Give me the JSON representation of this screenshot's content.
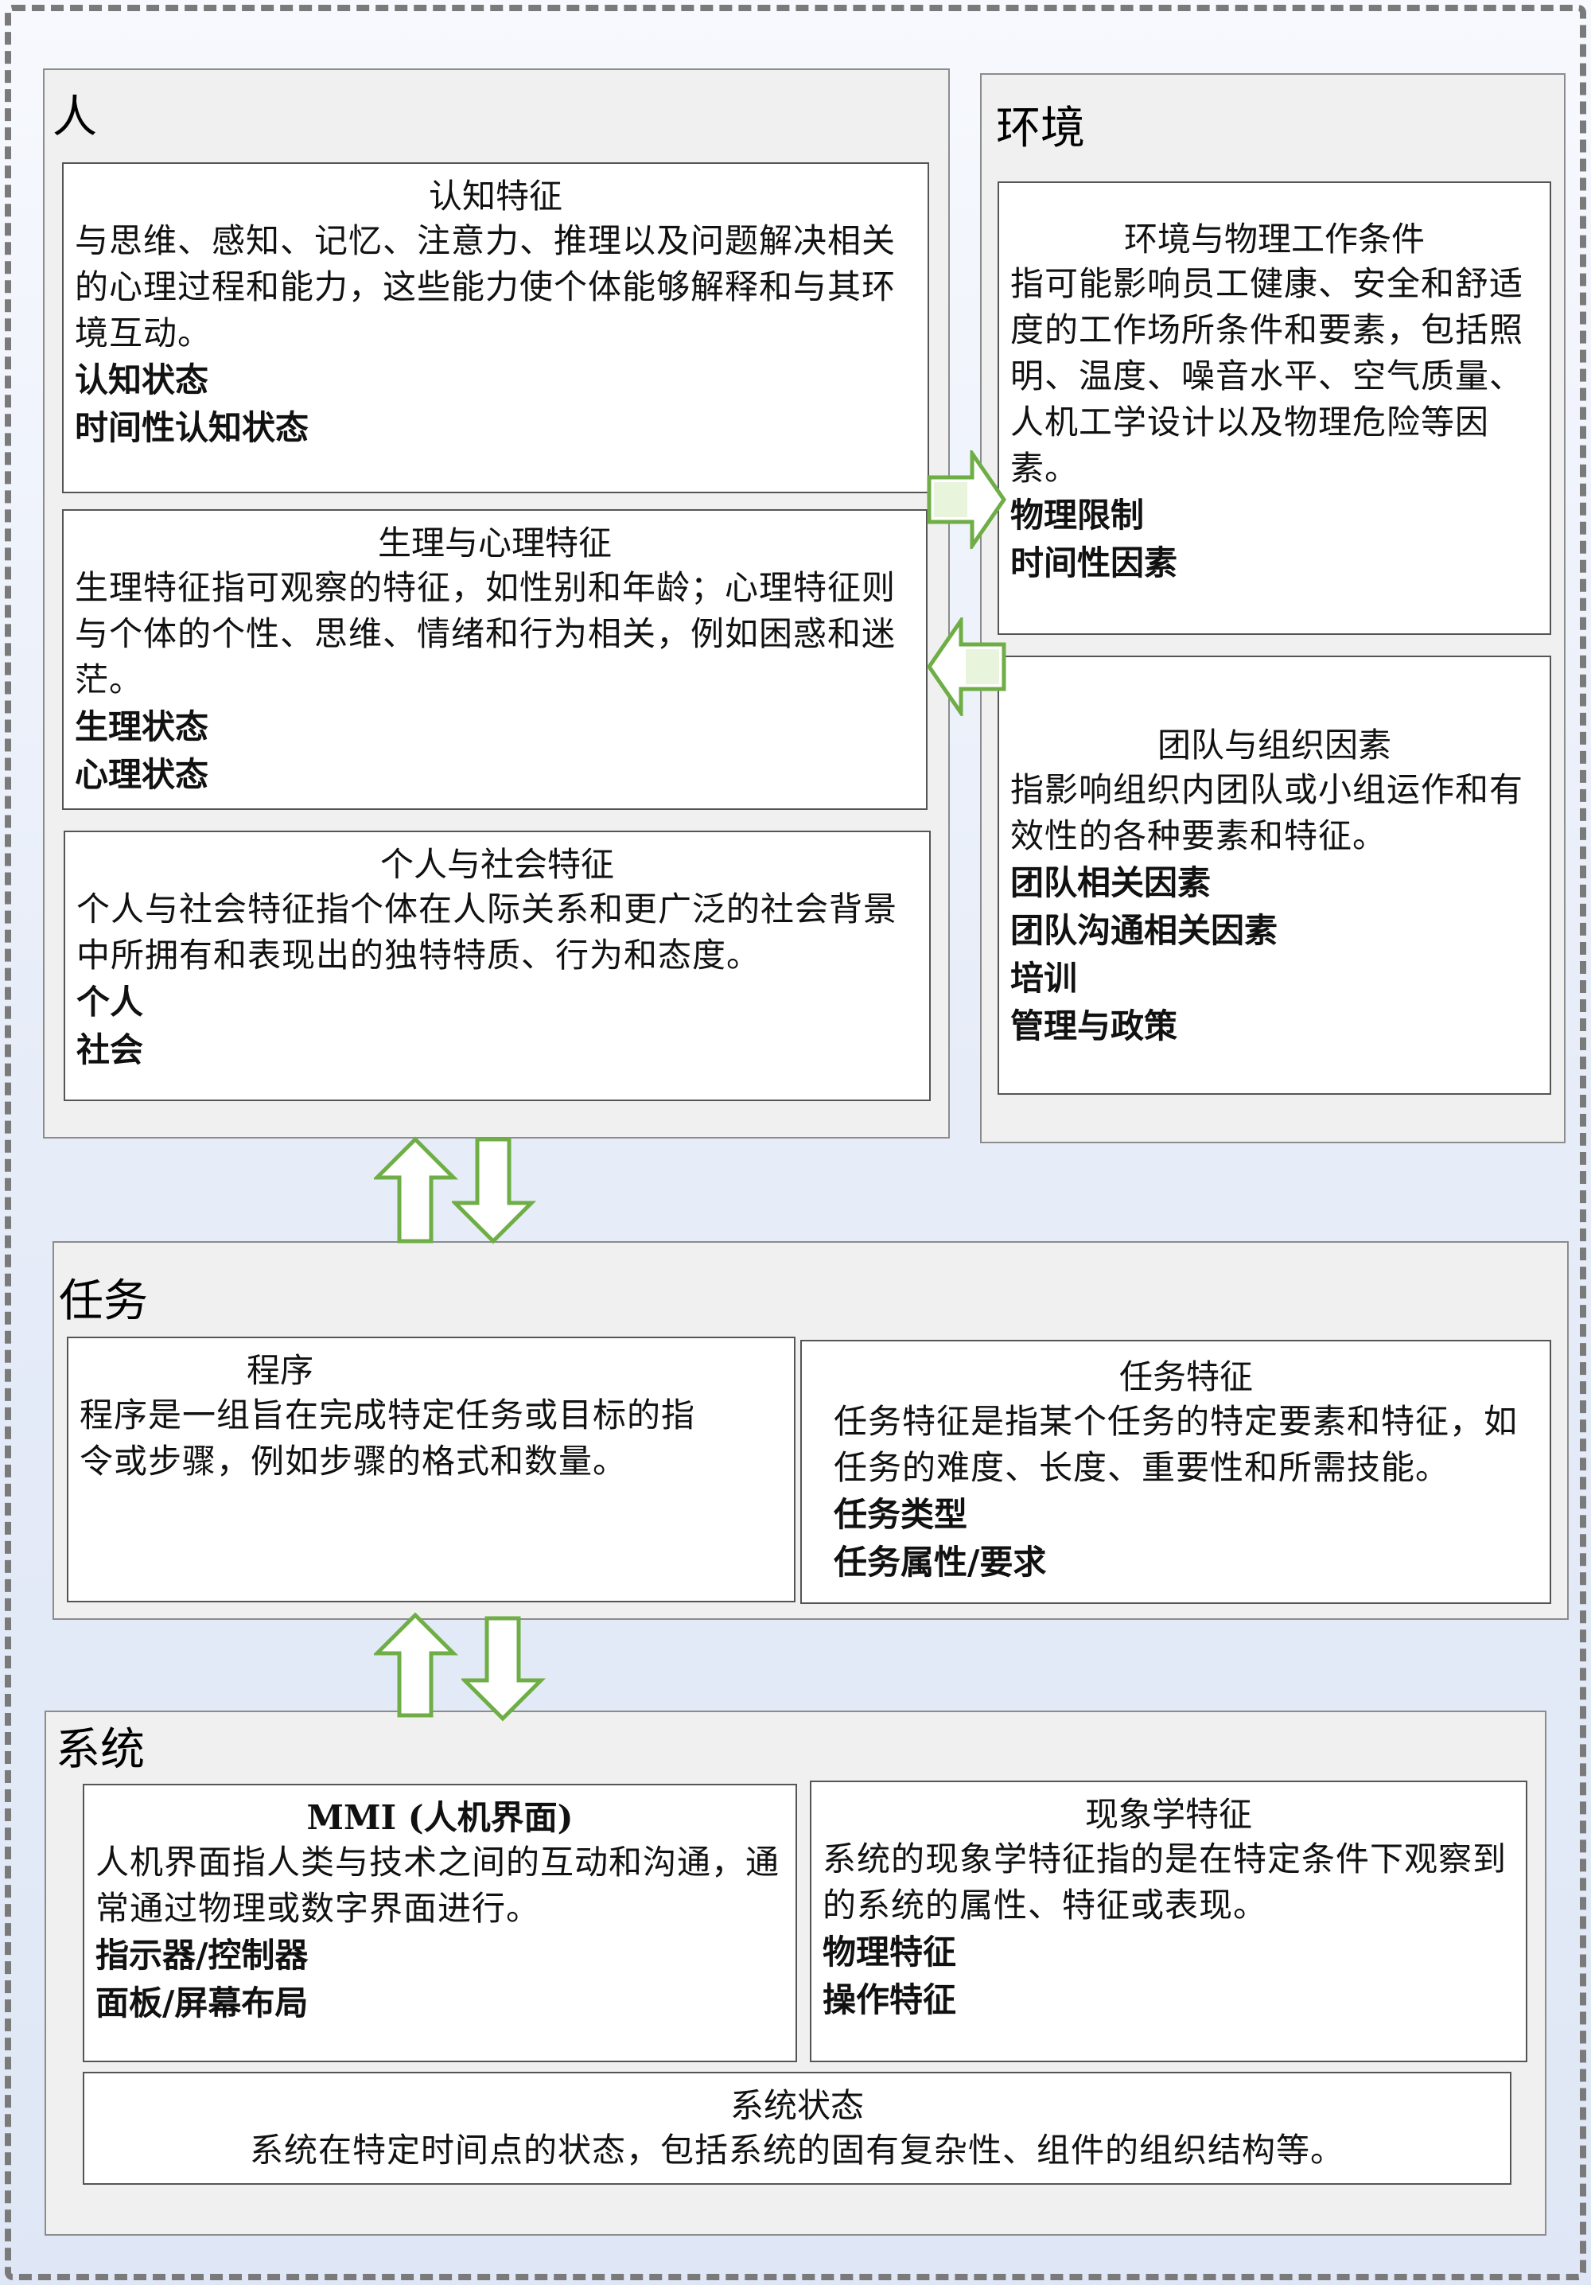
{
  "groups": {
    "person": {
      "title": "人",
      "cognitive": {
        "title": "认知特征",
        "desc": "与思维、感知、记忆、注意力、推理以及问题解决相关的心理过程和能力，这些能力使个体能够解释和与其环境互动。",
        "items": [
          "认知状态",
          "时间性认知状态"
        ]
      },
      "physio": {
        "title": "生理与心理特征",
        "desc": "生理特征指可观察的特征，如性别和年龄；心理特征则与个体的个性、思维、情绪和行为相关，例如困惑和迷茫。",
        "items": [
          "生理状态",
          "心理状态"
        ]
      },
      "social": {
        "title": "个人与社会特征",
        "desc": "个人与社会特征指个体在人际关系和更广泛的社会背景中所拥有和表现出的独特特质、行为和态度。",
        "items": [
          "个人",
          "社会"
        ]
      }
    },
    "environment": {
      "title": "环境",
      "physical": {
        "title": "环境与物理工作条件",
        "desc": "指可能影响员工健康、安全和舒适度的工作场所条件和要素，包括照明、温度、噪音水平、空气质量、人机工学设计以及物理危险等因素。",
        "items": [
          "物理限制",
          "时间性因素"
        ]
      },
      "team": {
        "title": "团队与组织因素",
        "desc": "指影响组织内团队或小组运作和有效性的各种要素和特征。",
        "items": [
          "团队相关因素",
          "团队沟通相关因素",
          "培训",
          "管理与政策"
        ]
      }
    },
    "task": {
      "title": "任务",
      "procedure": {
        "title": "程序",
        "desc": "程序是一组旨在完成特定任务或目标的指令或步骤，例如步骤的格式和数量。",
        "items": []
      },
      "characteristics": {
        "title": "任务特征",
        "desc": "任务特征是指某个任务的特定要素和特征，如任务的难度、长度、重要性和所需技能。",
        "items": [
          "任务类型",
          "任务属性/要求"
        ]
      }
    },
    "system": {
      "title": "系统",
      "mmi": {
        "title": "MMI (人机界面)",
        "desc": "人机界面指人类与技术之间的互动和沟通，通常通过物理或数字界面进行。",
        "items": [
          "指示器/控制器",
          "面板/屏幕布局"
        ]
      },
      "phenomenology": {
        "title": "现象学特征",
        "desc": "系统的现象学特征指的是在特定条件下观察到的系统的属性、特征或表现。",
        "items": [
          "物理特征",
          "操作特征"
        ]
      },
      "state": {
        "title": "系统状态",
        "desc": "系统在特定时间点的状态，包括系统的固有复杂性、组件的组织结构等。"
      }
    }
  },
  "colors": {
    "arrow_fill": "#ffffff",
    "arrow_stroke": "#6fae46",
    "arrow_shadow": "#9fd07a",
    "group_bg": "#f0f0f0",
    "card_bg": "#ffffff",
    "border_dashed": "#7a7a7a"
  }
}
